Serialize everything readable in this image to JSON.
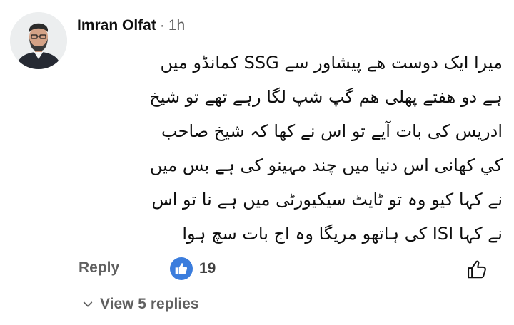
{
  "comment": {
    "author": "Imran Olfat",
    "separator": "·",
    "timestamp": "1h",
    "lines": [
      "میرا ایک دوست ھے پیشاور سے SSG کمانڈو میں",
      "ہے دو ھفتے پھلی ھم گپ شپ لگا رہے تھے تو شیخ",
      "ادریس کی بات آیے تو اس نے کھا کہ شیخ صاحب",
      "کي کھانی اس دنیا میں چند مہینو کی ہے بس میں",
      "نے کہا کیو وہ تو ٹایٹ سیکیورٹی میں ہے نا تو اس",
      "نے کہا ISI کی ہاتھو مریگا وہ اج بات سچ ہوا"
    ]
  },
  "actions": {
    "reply_label": "Reply",
    "like_count": "19",
    "like_badge_icon": "thumbs-up-badge-icon",
    "like_button_icon": "thumbs-up-outline-icon",
    "like_badge_color": "#3b7ddd"
  },
  "replies": {
    "toggle_label": "View 5 replies",
    "toggle_icon": "chevron-down-icon"
  }
}
